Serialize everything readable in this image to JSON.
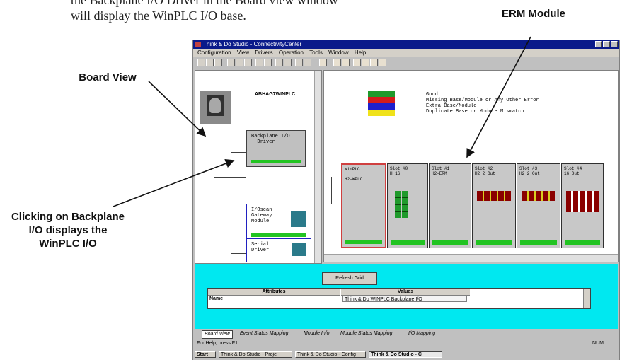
{
  "intro": {
    "line1": "the Backplane I/O Driver in the Board view window",
    "line2": "will display the WinPLC I/O base."
  },
  "callouts": {
    "erm": "ERM Module",
    "board_view": "Board View",
    "clicking_1": "Clicking on Backplane",
    "clicking_2": "I/O displays the",
    "clicking_3": "WinPLC I/O"
  },
  "window": {
    "title": "Think & Do Studio - ConnectivityCenter",
    "menu": [
      "Configuration",
      "View",
      "Drivers",
      "Operation",
      "Tools",
      "Window",
      "Help"
    ],
    "tree": {
      "pc_label": "ABHAG7WINPLC",
      "nodes": [
        {
          "label": "Backplane I/O\n  Driver"
        },
        {
          "label": "I/Oscan\nGateway\nModule"
        },
        {
          "label": "Serial\nDriver"
        }
      ]
    },
    "legend": [
      {
        "text": "Good",
        "color": "#1f9a2b"
      },
      {
        "text": "Missing Base/Module or Any Other Error",
        "color": "#d41c1c"
      },
      {
        "text": "Extra Base/Module",
        "color": "#1f1fcc"
      },
      {
        "text": "Duplicate Base or Module Mismatch",
        "color": "#f0e21a"
      }
    ],
    "modules": [
      {
        "label": "WinPLC\n\nH2-WPLC"
      },
      {
        "label": "Slot #0\nH 16"
      },
      {
        "label": "Slot #1\nH2-ERM"
      },
      {
        "label": "Slot #2\nH2 2 Out"
      },
      {
        "label": "Slot #3\nH2 2 Out"
      },
      {
        "label": "Slot #4\n16 Out"
      }
    ],
    "refresh_label": "Refresh Grid",
    "grid": {
      "headers": [
        "Attributes",
        "Values"
      ],
      "row_name": "Name",
      "row_value": "Think & Do WINPLC Backplane I/O"
    },
    "tabs": [
      "Board View",
      "Event Status Mapping",
      "Module Info",
      "Module Status Mapping",
      "I/O Mapping"
    ],
    "status_text": "For Help, press F1",
    "status_right": "NUM",
    "taskbar": [
      "Start",
      "Think & Do Studio - Proje",
      "Think & Do Studio - Config",
      "Think & Do Studio - C"
    ]
  }
}
